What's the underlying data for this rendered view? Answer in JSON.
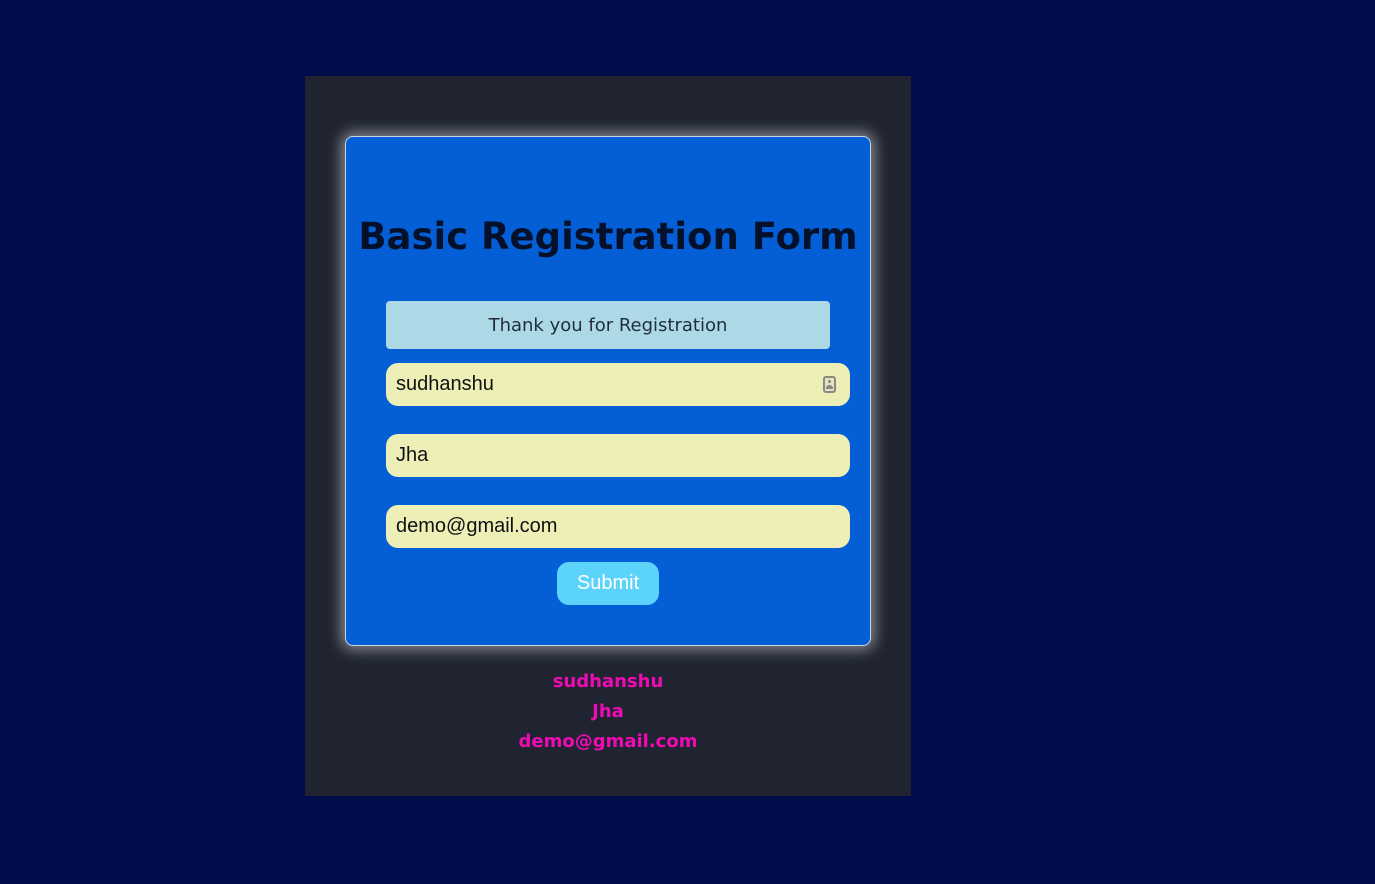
{
  "form": {
    "title": "Basic Registration Form",
    "success_message": "Thank you for Registration",
    "fields": {
      "first_name": "sudhanshu",
      "last_name": "Jha",
      "email": "demo@gmail.com"
    },
    "submit_label": "Submit",
    "autofill_icon": "contact-card-icon"
  },
  "output": {
    "first_name": "sudhanshu",
    "last_name": "Jha",
    "email": "demo@gmail.com"
  },
  "colors": {
    "page_background": "#000d4a",
    "container_background": "#1f2430",
    "card_background": "#045fd7",
    "banner_background": "#add8e6",
    "input_background": "#eeeeb7",
    "button_background": "#5bd3fb",
    "output_text": "#f00ab4"
  }
}
